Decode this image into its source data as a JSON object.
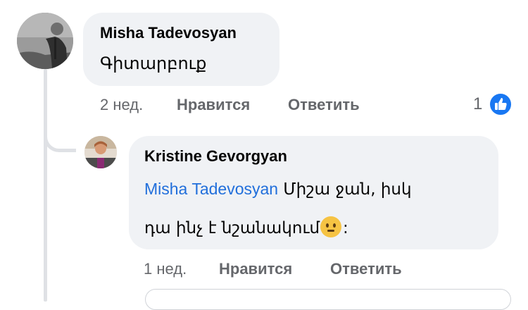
{
  "comments": [
    {
      "author": "Misha Tadevosyan",
      "text": "Գիտարբուք",
      "time": "2 нед.",
      "like_label": "Нравится",
      "reply_label": "Ответить",
      "reaction_count": "1",
      "avatar_icon": "user-avatar-photo"
    }
  ],
  "replies": [
    {
      "author": "Kristine Gevorgyan",
      "mention": "Misha Tadevosyan",
      "text_line1": " Միշա ջան, իսկ",
      "text_line2": "դա ինչ է նշանակում",
      "emoji_icon": "thinking-face-emoji",
      "text_tail": ":",
      "time": "1 нед.",
      "like_label": "Нравится",
      "reply_label": "Ответить",
      "avatar_icon": "user-avatar-photo"
    }
  ],
  "colors": {
    "bubble": "#f0f2f5",
    "mention": "#216fdb",
    "meta": "#65676b",
    "like_badge": "#1877f2",
    "thread_line": "#dfe1e5"
  }
}
